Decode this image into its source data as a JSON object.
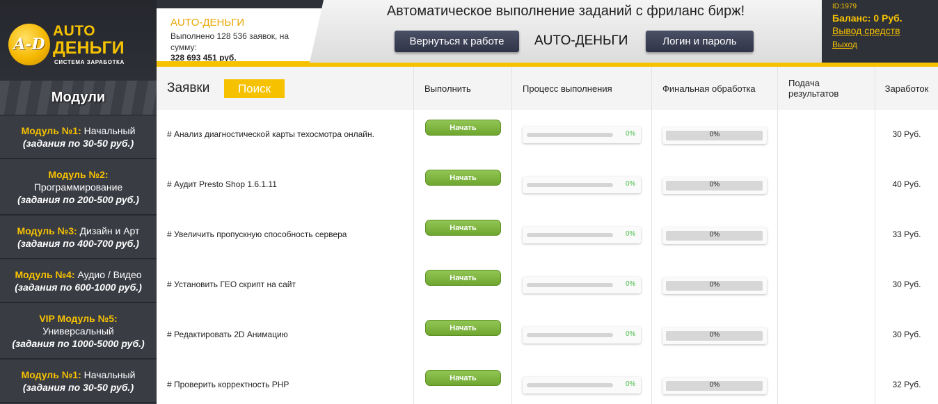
{
  "logo": {
    "badge": "A-D",
    "line1": "AUTO",
    "line2": "ДЕНЬГИ",
    "subtitle": "СИСТЕМА ЗАРАБОТКА"
  },
  "sidebar": {
    "heading": "Модули",
    "items": [
      {
        "name": "Модуль №1:",
        "desc": "Начальный",
        "range": "(задания по 30-50 руб.)"
      },
      {
        "name": "Модуль №2:",
        "desc": "Программирование",
        "range": "(задания по 200-500 руб.)"
      },
      {
        "name": "Модуль №3:",
        "desc": "Дизайн и Арт",
        "range": "(задания по 400-700 руб.)"
      },
      {
        "name": "Модуль №4:",
        "desc": "Аудио / Видео",
        "range": "(задания по 600-1000 руб.)"
      },
      {
        "name": "VIP Модуль №5:",
        "desc": "Универсальный",
        "range": "(задания по 1000-5000 руб.)"
      },
      {
        "name": "Модуль №1:",
        "desc": "Начальный",
        "range": "(задания по 30-50 руб.)"
      }
    ]
  },
  "info": {
    "title": "AUTO-ДЕНЬГИ",
    "text": "Выполнено 128 536 заявок, на сумму:",
    "sum": "328 693 451 руб."
  },
  "banner": {
    "title": "Автоматическое выполнение заданий с фриланс бирж!",
    "back_button": "Вернуться к работе",
    "brand": "AUTO-ДЕНЬГИ",
    "login_button": "Логин и пароль"
  },
  "account": {
    "id": "ID:1979",
    "balance": "Баланс: 0 Руб.",
    "withdraw": "Вывод средств",
    "logout": "Выход"
  },
  "table": {
    "title": "Заявки",
    "search_button": "Поиск",
    "columns": {
      "execute": "Выполнить",
      "process": "Процесс выполнения",
      "final": "Финальная обработка",
      "submit": "Подача результатов",
      "earned": "Заработок"
    },
    "start_label": "Начать",
    "rows": [
      {
        "task": "# Анализ диагностической карты техосмотра онлайн.",
        "progress": "0%",
        "final": "0%",
        "earned": "30 Руб."
      },
      {
        "task": "# Аудит Presto Shop 1.6.1.11",
        "progress": "0%",
        "final": "0%",
        "earned": "40 Руб."
      },
      {
        "task": "# Увеличить пропускную способность сервера",
        "progress": "0%",
        "final": "0%",
        "earned": "33 Руб."
      },
      {
        "task": "# Установить ГЕО скрипт на сайт",
        "progress": "0%",
        "final": "0%",
        "earned": "30 Руб."
      },
      {
        "task": "# Редактировать 2D Анимацию",
        "progress": "0%",
        "final": "0%",
        "earned": "30 Руб."
      },
      {
        "task": "# Проверить корректность PHP",
        "progress": "0%",
        "final": "0%",
        "earned": "32 Руб."
      }
    ]
  },
  "colors": {
    "accent": "#f6c200",
    "dark": "#2f3138",
    "start_green": "#7fb640",
    "percent_green": "#4fbf4f"
  }
}
